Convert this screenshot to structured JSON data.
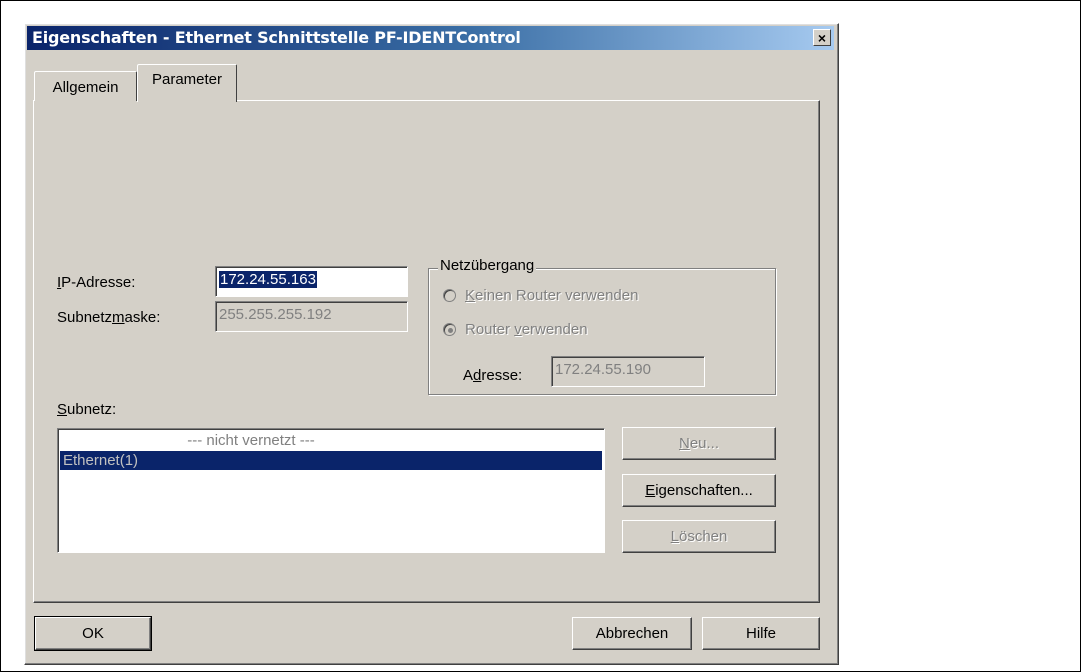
{
  "window": {
    "title": "Eigenschaften - Ethernet Schnittstelle  PF-IDENTControl",
    "close_glyph": "×"
  },
  "tabs": [
    {
      "label": "Allgemein",
      "active": false
    },
    {
      "label": "Parameter",
      "active": true
    }
  ],
  "ip": {
    "label_pre": "",
    "label_mnemonic": "I",
    "label_post": "P-Adresse:",
    "value": "172.24.55.163"
  },
  "subnet_mask": {
    "label_pre": "Subnetz",
    "label_mnemonic": "m",
    "label_post": "aske:",
    "value": "255.255.255.192"
  },
  "gateway": {
    "title": "Netzübergang",
    "no_router": {
      "pre": "",
      "mnemonic": "K",
      "post": "einen Router verwenden"
    },
    "use_router": {
      "pre": "Router ",
      "mnemonic": "v",
      "post": "erwenden"
    },
    "address": {
      "pre": "A",
      "mnemonic": "d",
      "post": "resse:",
      "value": "172.24.55.190"
    }
  },
  "subnet": {
    "label_pre": "",
    "label_mnemonic": "S",
    "label_post": "ubnetz:",
    "items": [
      "--- nicht vernetzt ---",
      "Ethernet(1)"
    ]
  },
  "side_buttons": {
    "new": {
      "pre": "",
      "mnemonic": "N",
      "post": "eu..."
    },
    "properties": {
      "pre": "",
      "mnemonic": "E",
      "post": "igenschaften..."
    },
    "delete": {
      "pre": "",
      "mnemonic": "L",
      "post": "öschen"
    }
  },
  "footer": {
    "ok": "OK",
    "cancel": "Abbrechen",
    "help": "Hilfe"
  },
  "colors": {
    "dialog_face": "#d4d0c8",
    "titlebar_start": "#0a246a",
    "titlebar_end": "#a6caf0",
    "selection": "#0a246a"
  }
}
